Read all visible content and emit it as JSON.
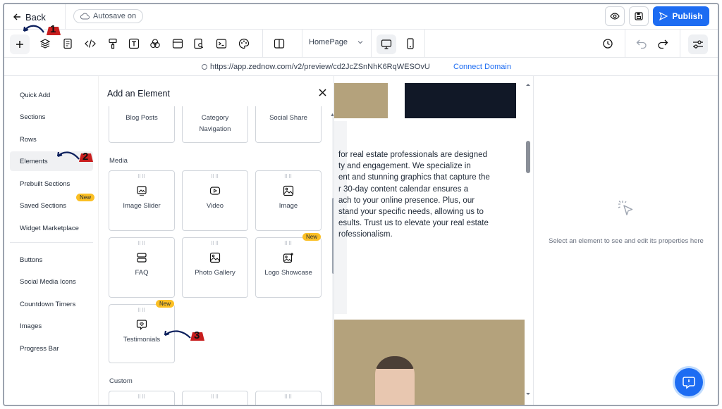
{
  "topbar": {
    "back_label": "Back",
    "autosave_label": "Autosave on",
    "publish_label": "Publish"
  },
  "toolbar": {
    "page_select_value": "HomePage"
  },
  "urlbar": {
    "url": "https://app.zednow.com/v2/preview/cd2JcZSnNhK6RqWESOvU",
    "connect_label": "Connect Domain"
  },
  "leftnav": {
    "items": [
      {
        "label": "Quick Add"
      },
      {
        "label": "Sections"
      },
      {
        "label": "Rows"
      },
      {
        "label": "Elements"
      },
      {
        "label": "Prebuilt Sections"
      },
      {
        "label": "Saved Sections"
      },
      {
        "label": "Widget Marketplace"
      },
      {
        "label": "Buttons"
      },
      {
        "label": "Social Media Icons"
      },
      {
        "label": "Countdown Timers"
      },
      {
        "label": "Images"
      },
      {
        "label": "Progress Bar"
      }
    ],
    "saved_badge": "New"
  },
  "panel": {
    "title": "Add an Element",
    "top_cards": [
      {
        "label": "Blog Posts"
      },
      {
        "label": "Category Navigation"
      },
      {
        "label": "Social Share"
      }
    ],
    "media_label": "Media",
    "media_cards": [
      {
        "label": "Image Slider",
        "icon": "image-slider-icon"
      },
      {
        "label": "Video",
        "icon": "video-icon"
      },
      {
        "label": "Image",
        "icon": "image-icon"
      },
      {
        "label": "FAQ",
        "icon": "faq-icon"
      },
      {
        "label": "Photo Gallery",
        "icon": "photo-gallery-icon"
      },
      {
        "label": "Logo Showcase",
        "icon": "logo-showcase-icon"
      },
      {
        "label": "Testimonials",
        "icon": "testimonials-icon"
      }
    ],
    "new_badge": "New",
    "custom_label": "Custom"
  },
  "canvas": {
    "paragraph": "for real estate professionals are designed ty and engagement. We specialize in ent and stunning graphics that capture the r 30-day content calendar ensures a ach to your online presence. Plus, our stand your specific needs, allowing us to esults. Trust us to elevate your real estate rofessionalism.",
    "lines": [
      "for real estate professionals are designed",
      "ty and engagement. We specialize in",
      "ent and stunning graphics that capture the",
      "r 30-day content calendar ensures a",
      "ach to your online presence. Plus, our",
      "stand your specific needs, allowing us to",
      "esults. Trust us to elevate your real estate",
      "rofessionalism."
    ]
  },
  "props": {
    "empty_text": "Select an element to see and edit its properties here"
  },
  "annotations": {
    "step1": "1",
    "step2": "2",
    "step3": "3"
  },
  "colors": {
    "accent": "#1d6cf2",
    "badge": "#fbbf24",
    "annotation": "#c81e1e",
    "tan": "#b4a27c"
  }
}
